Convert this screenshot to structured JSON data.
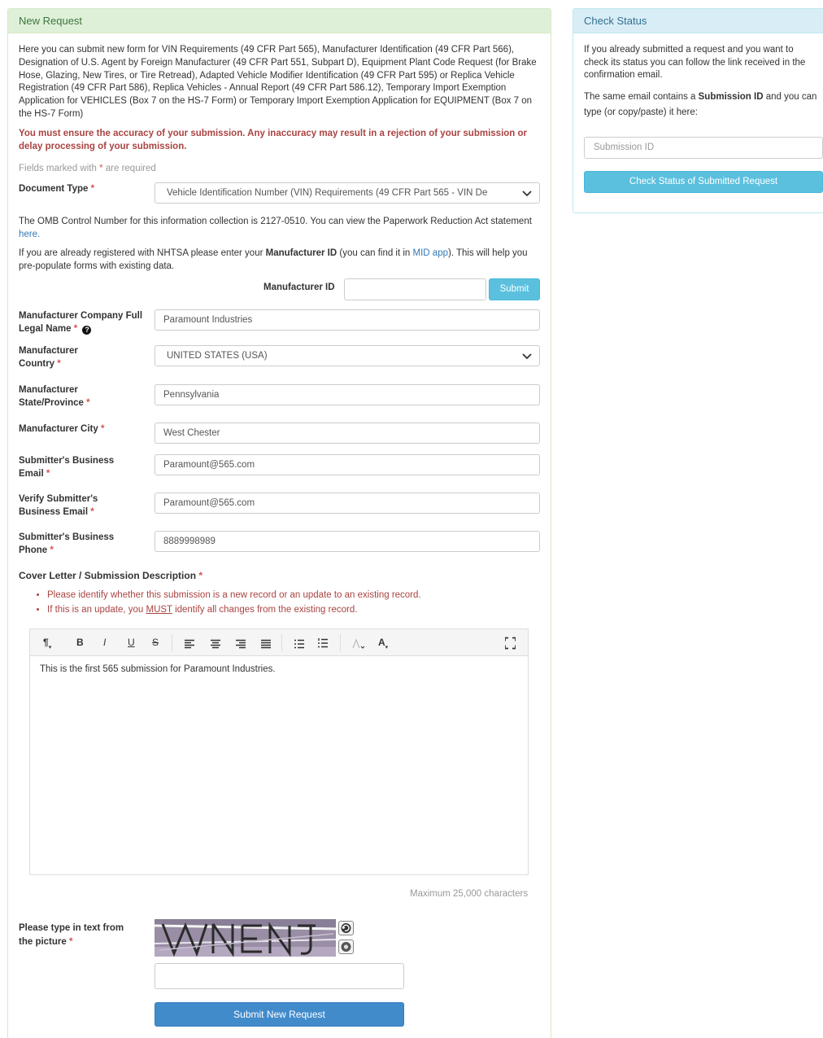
{
  "new_request": {
    "heading": "New Request",
    "intro": "Here you can submit new form for VIN Requirements (49 CFR Part 565), Manufacturer Identification (49 CFR Part 566), Designation of U.S. Agent by Foreign Manufacturer (49 CFR Part 551, Subpart D), Equipment Plant Code Request (for Brake Hose, Glazing, New Tires, or Tire Retread), Adapted Vehicle Modifier Identification (49 CFR Part 595) or Replica Vehicle Registration (49 CFR Part 586), Replica Vehicles - Annual Report (49 CFR Part 586.12), Temporary Import Exemption Application for VEHICLES (Box 7 on the HS-7 Form) or Temporary Import Exemption Application for EQUIPMENT (Box 7 on the HS-7 Form)",
    "warning": "You must ensure the accuracy of your submission. Any inaccuracy may result in a rejection of your submission or delay processing of your submission.",
    "required_note_prefix": "Fields marked with",
    "required_note_suffix": "are required",
    "required_marker": "*",
    "document_type": {
      "label": "Document Type",
      "value": "Vehicle Identification Number (VIN) Requirements (49 CFR Part 565 - VIN De"
    },
    "omb": {
      "text": "The OMB Control Number for this information collection is 2127-0510. You can view the Paperwork Reduction Act statement",
      "link": "here."
    },
    "mid_info": {
      "part1": "If you are already registered with NHTSA please enter your",
      "bold": "Manufacturer ID",
      "part2": "(you can find it in",
      "link": "MID app",
      "part3": "). This will help you pre-populate forms with existing data."
    },
    "manufacturer_id": {
      "label": "Manufacturer ID",
      "value": "",
      "submit_label": "Submit"
    },
    "fields": {
      "company_name": {
        "label": "Manufacturer Company Full Legal Name",
        "value": "Paramount Industries"
      },
      "country": {
        "label": "Manufacturer Country",
        "value": "UNITED STATES (USA)"
      },
      "state": {
        "label": "Manufacturer State/Province",
        "value": "Pennsylvania"
      },
      "city": {
        "label": "Manufacturer City",
        "value": "West Chester"
      },
      "email": {
        "label": "Submitter's Business Email",
        "value": "Paramount@565.com"
      },
      "verify_email": {
        "label": "Verify Submitter's Business Email",
        "value": "Paramount@565.com"
      },
      "phone": {
        "label": "Submitter's Business Phone",
        "value": "8889998989"
      }
    },
    "cover_letter": {
      "label": "Cover Letter / Submission Description",
      "instruction1": "Please identify whether this submission is a new record or an update to an existing record.",
      "instruction2_pre": "If this is an update, you",
      "instruction2_em": "MUST",
      "instruction2_post": "identify all changes from the existing record.",
      "body": "This is the first 565 submission for Paramount Industries.",
      "max_chars": "Maximum 25,000 characters"
    },
    "editor_toolbar": {
      "paragraph": "¶",
      "bold": "B",
      "italic": "I",
      "underline": "U",
      "strike": "S",
      "color": "A"
    },
    "captcha": {
      "label": "Please type in text from the picture",
      "value": ""
    },
    "submit_label": "Submit New Request"
  },
  "check_status": {
    "heading": "Check Status",
    "text1": "If you already submitted a request and you want to check its status you can follow the link received in the confirmation email.",
    "text2_pre": "The same email contains a",
    "text2_bold": "Submission ID",
    "text2_post": "and you can type (or copy/paste) it here:",
    "input_placeholder": "Submission ID",
    "button_label": "Check Status of Submitted Request"
  },
  "colors": {
    "success_bg": "#dff0d8",
    "success_text": "#3c763d",
    "info_bg": "#d9edf7",
    "info_text": "#31708f",
    "danger_text": "#a94442",
    "info_button": "#5bc0de",
    "primary_button": "#428bca"
  }
}
